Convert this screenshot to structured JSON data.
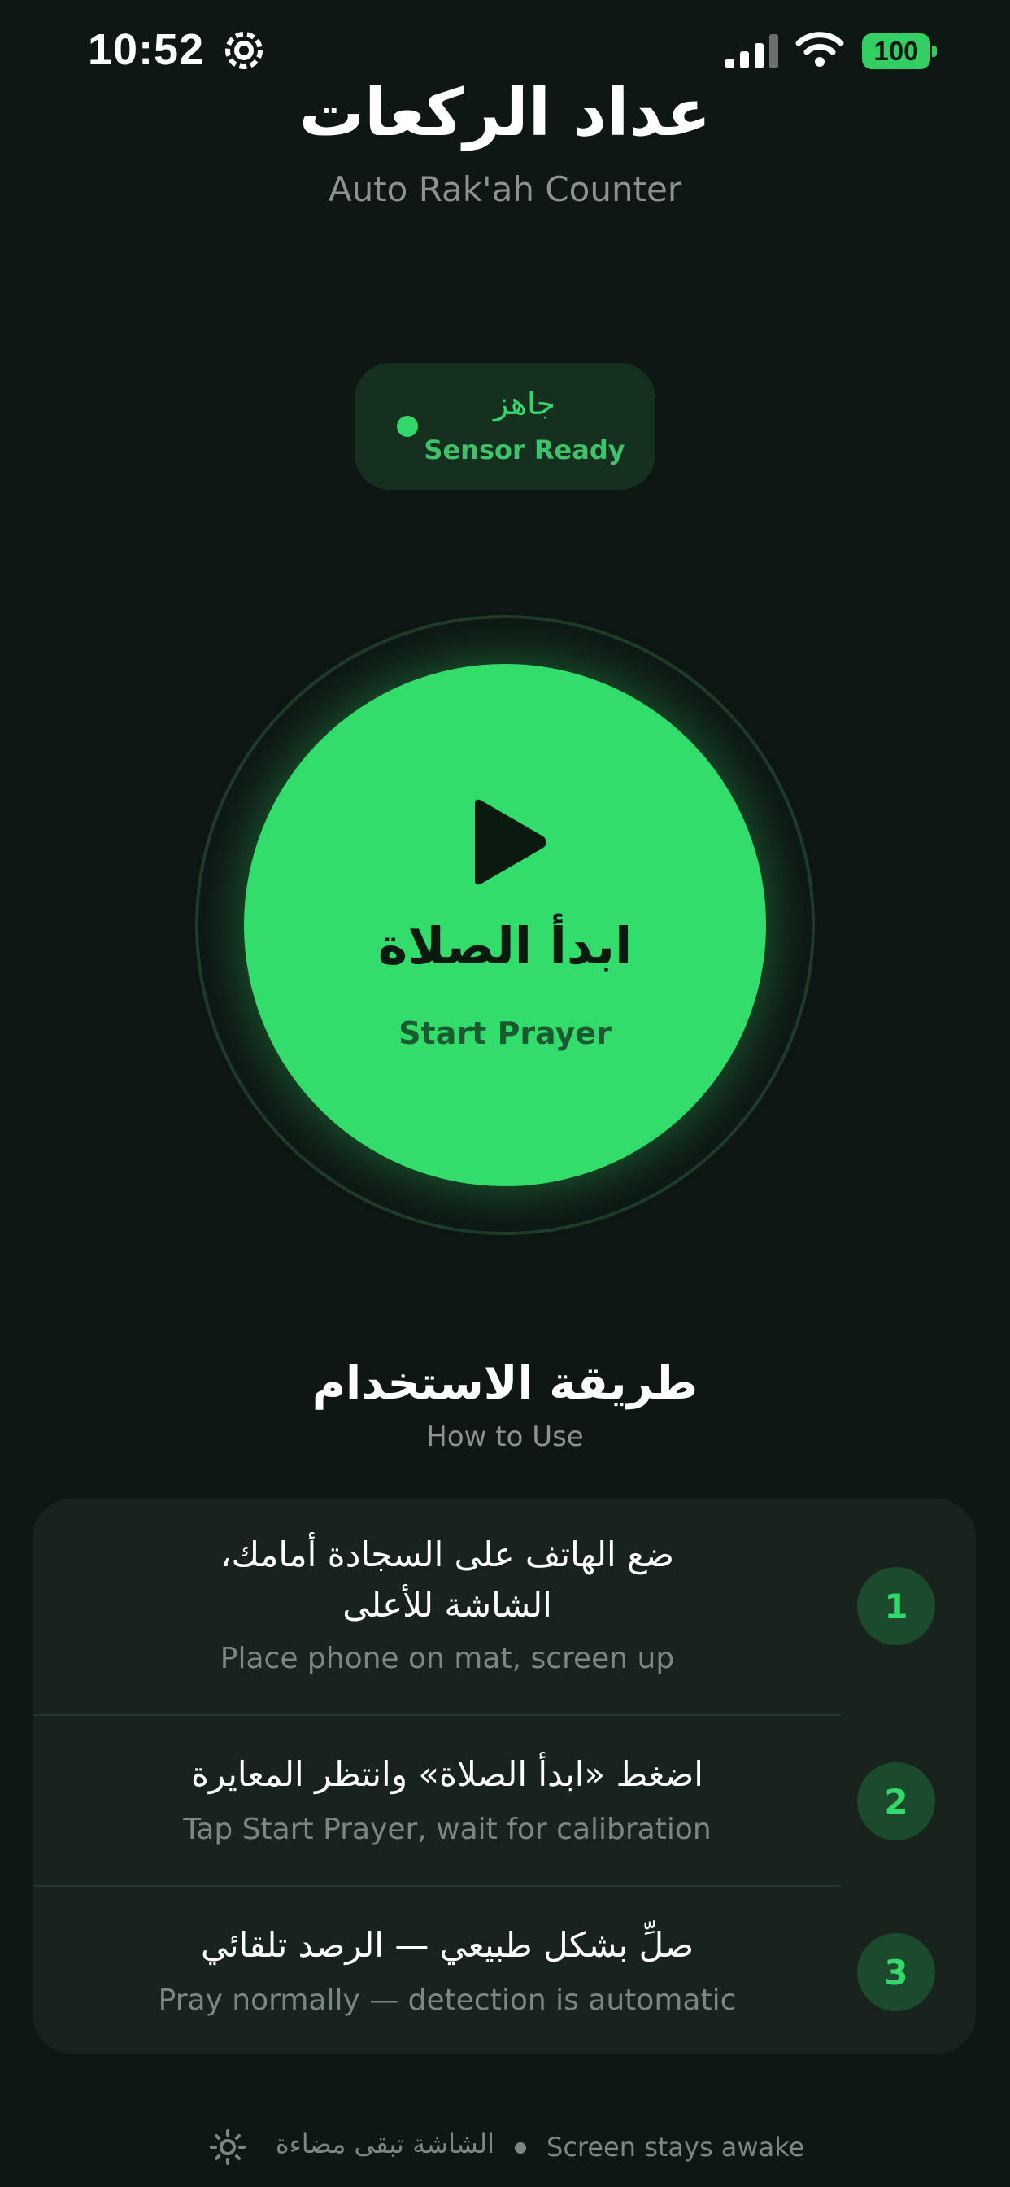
{
  "status_bar": {
    "time": "10:52",
    "battery": "100",
    "icons": [
      "gear-icon",
      "signal-icon",
      "wifi-icon",
      "battery-icon"
    ]
  },
  "header": {
    "title": "عداد الركعات",
    "subtitle": "Auto Rak'ah Counter"
  },
  "sensor_status": {
    "label_ar": "جاهز",
    "label_en": "Sensor Ready",
    "color": "#33d86a"
  },
  "start_button": {
    "label_ar": "ابدأ الصلاة",
    "label_en": "Start Prayer",
    "icon": "play-icon",
    "color": "#33dd6b"
  },
  "how_to_use": {
    "title_ar": "طريقة الاستخدام",
    "title_en": "How to Use",
    "steps": [
      {
        "number": "1",
        "line1_ar": "ضع الهاتف على السجادة أمامك،",
        "line2_ar": "الشاشة للأعلى",
        "text_en": "Place phone on mat, screen up"
      },
      {
        "number": "2",
        "line1_ar": "اضغط «ابدأ الصلاة» وانتظر المعايرة",
        "text_en": "Tap Start Prayer, wait for calibration"
      },
      {
        "number": "3",
        "line1_ar": "صلِّ بشكل طبيعي — الرصد تلقائي",
        "text_en": "Pray normally — detection is automatic"
      }
    ]
  },
  "footer": {
    "text_ar": "الشاشة تبقى مضاءة",
    "text_en": "Screen stays awake",
    "icon": "sun-icon"
  },
  "colors": {
    "background": "#0e1713",
    "accent": "#33dd6b",
    "card": "#17231c"
  }
}
